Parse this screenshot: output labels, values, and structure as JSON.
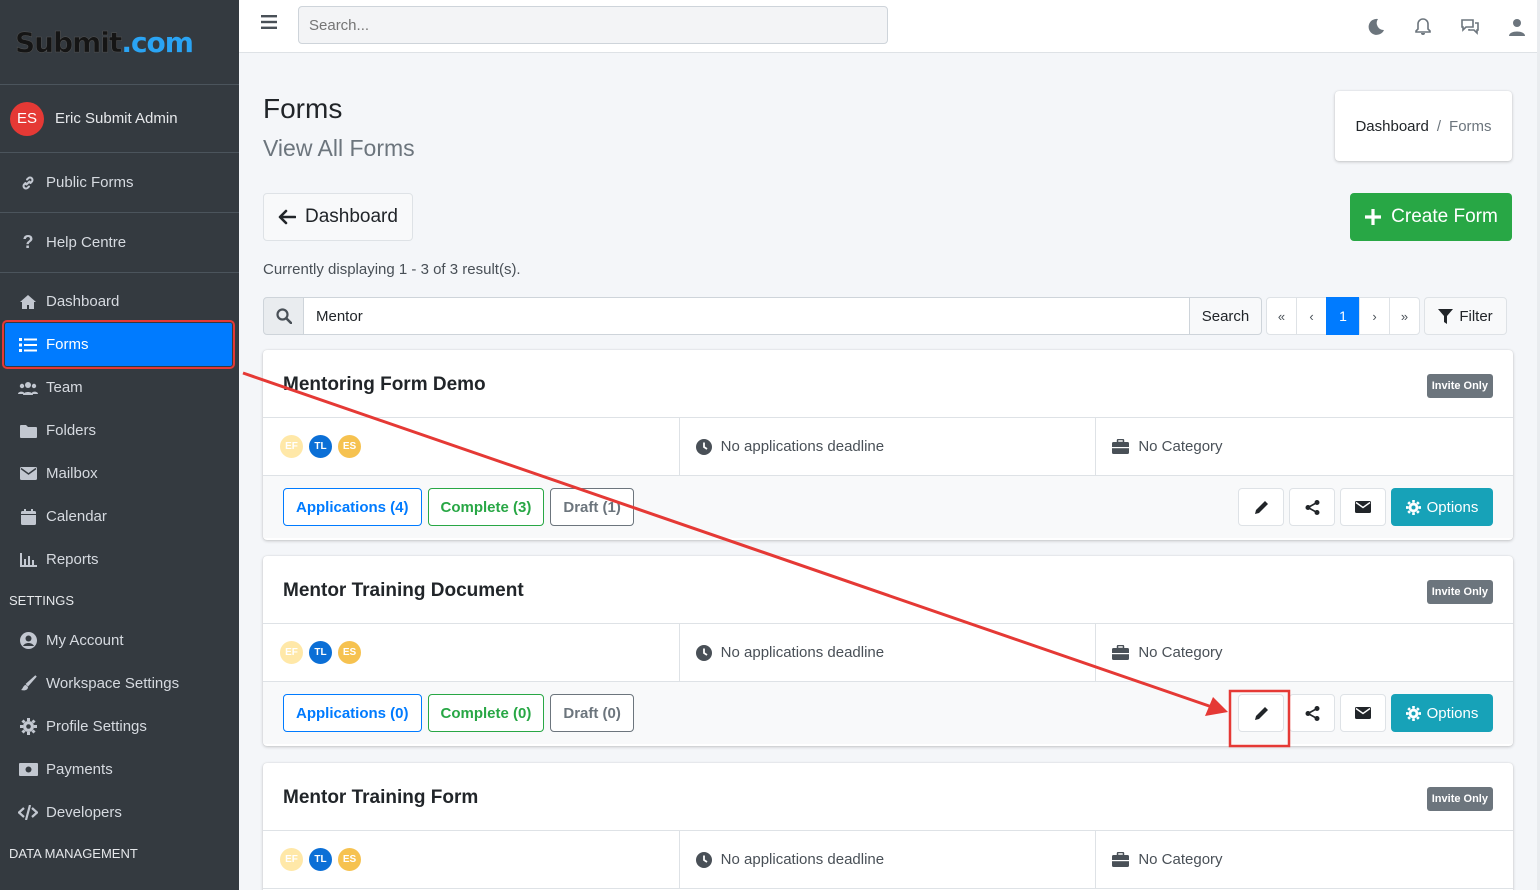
{
  "brand": {
    "part1": "Submit",
    "dot": ".",
    "part2": "com"
  },
  "user": {
    "initials": "ES",
    "name": "Eric Submit Admin"
  },
  "sidebar": {
    "public_forms": "Public Forms",
    "help_centre": "Help Centre",
    "items": [
      {
        "label": "Dashboard",
        "icon": "home-icon"
      },
      {
        "label": "Forms",
        "icon": "list-icon"
      },
      {
        "label": "Team",
        "icon": "users-icon"
      },
      {
        "label": "Folders",
        "icon": "folder-icon"
      },
      {
        "label": "Mailbox",
        "icon": "envelope-icon"
      },
      {
        "label": "Calendar",
        "icon": "calendar-icon"
      },
      {
        "label": "Reports",
        "icon": "chart-icon"
      }
    ],
    "settings_header": "SETTINGS",
    "settings": [
      {
        "label": "My Account",
        "icon": "user-circle-icon"
      },
      {
        "label": "Workspace Settings",
        "icon": "brush-icon"
      },
      {
        "label": "Profile Settings",
        "icon": "cog-icon"
      },
      {
        "label": "Payments",
        "icon": "money-icon"
      },
      {
        "label": "Developers",
        "icon": "code-icon"
      }
    ],
    "data_header": "DATA MANAGEMENT"
  },
  "topbar": {
    "search_placeholder": "Search..."
  },
  "page": {
    "title": "Forms",
    "subtitle": "View All Forms",
    "breadcrumb": {
      "home": "Dashboard",
      "sep": "/",
      "current": "Forms"
    },
    "back_label": "Dashboard",
    "create_label": "Create Form",
    "results": "Currently displaying 1 - 3 of 3 result(s).",
    "search_value": "Mentor",
    "search_button": "Search",
    "pager": {
      "first": "«",
      "prev": "‹",
      "current": "1",
      "next": "›",
      "last": "»"
    },
    "filter_label": "Filter"
  },
  "forms": [
    {
      "title": "Mentoring Form Demo",
      "badge": "Invite Only",
      "avatars": [
        "EF",
        "TL",
        "ES"
      ],
      "deadline": "No applications deadline",
      "category": "No Category",
      "applications": "Applications (4)",
      "complete": "Complete (3)",
      "draft": "Draft (1)",
      "options": "Options"
    },
    {
      "title": "Mentor Training Document",
      "badge": "Invite Only",
      "avatars": [
        "EF",
        "TL",
        "ES"
      ],
      "deadline": "No applications deadline",
      "category": "No Category",
      "applications": "Applications (0)",
      "complete": "Complete (0)",
      "draft": "Draft (0)",
      "options": "Options"
    },
    {
      "title": "Mentor Training Form",
      "badge": "Invite Only",
      "avatars": [
        "EF",
        "TL",
        "ES"
      ],
      "deadline": "No applications deadline",
      "category": "No Category"
    }
  ],
  "colors": {
    "sidebar": "#343a40",
    "primary": "#007bff",
    "success": "#28a745",
    "info": "#17a2b8",
    "annotation": "#e53935"
  }
}
